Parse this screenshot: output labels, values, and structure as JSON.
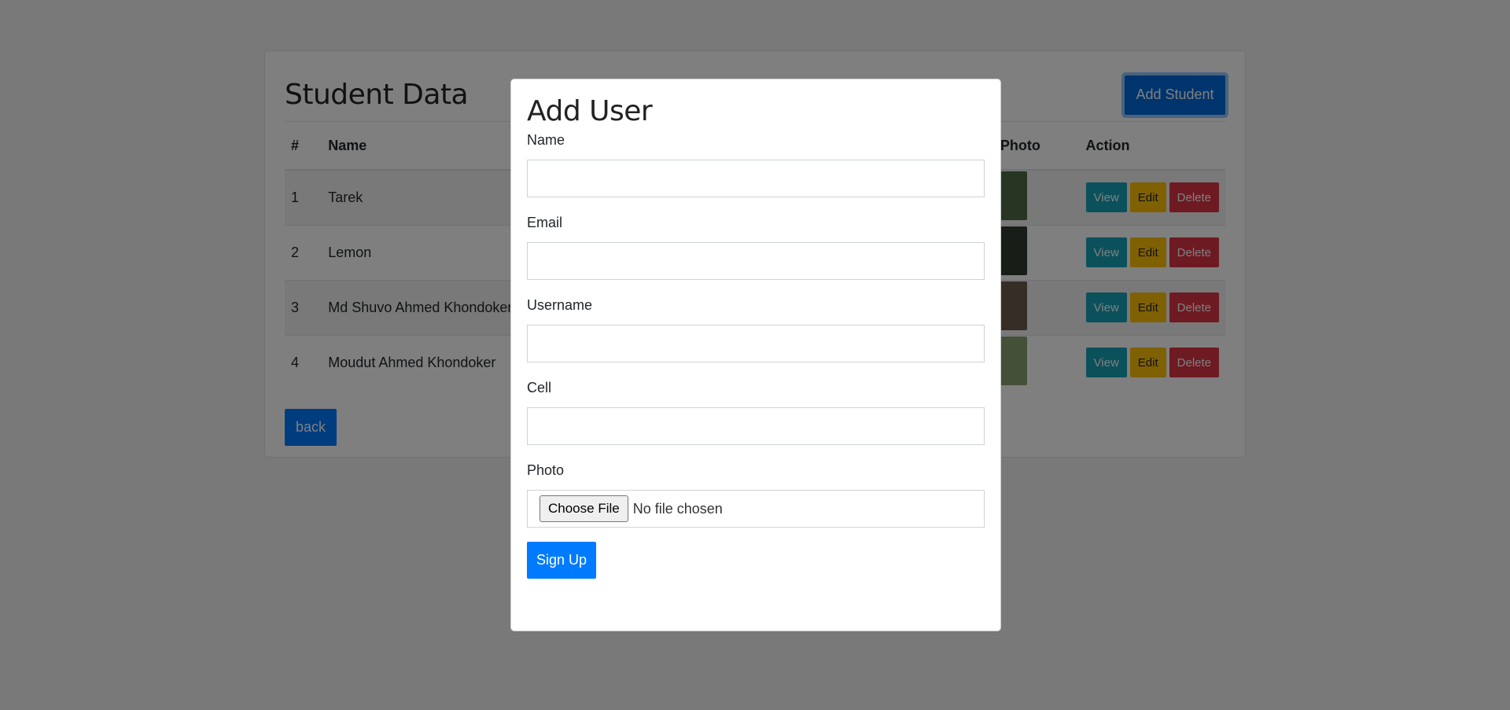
{
  "page": {
    "title": "Student Data",
    "add_button": "Add Student",
    "back_button": "back"
  },
  "table": {
    "headers": [
      "#",
      "Name",
      "Photo",
      "Action"
    ],
    "rows": [
      {
        "num": "1",
        "name": "Tarek",
        "photo_color": "#4f6b44"
      },
      {
        "num": "2",
        "name": "Lemon",
        "photo_color": "#2f3b2f"
      },
      {
        "num": "3",
        "name": "Md Shuvo Ahmed Khondoker",
        "photo_color": "#6e5a4e"
      },
      {
        "num": "4",
        "name": "Moudut Ahmed Khondoker",
        "photo_color": "#8aa070"
      }
    ],
    "actions": {
      "view": "View",
      "edit": "Edit",
      "delete": "Delete"
    }
  },
  "modal": {
    "title": "Add User",
    "fields": {
      "name": {
        "label": "Name",
        "value": ""
      },
      "email": {
        "label": "Email",
        "value": ""
      },
      "username": {
        "label": "Username",
        "value": ""
      },
      "cell": {
        "label": "Cell",
        "value": ""
      }
    },
    "photo": {
      "label": "Photo",
      "button": "Choose File",
      "status": "No file chosen"
    },
    "submit": "Sign Up"
  },
  "colors": {
    "primary": "#007bff",
    "info": "#17a2b8",
    "warning": "#ffc107",
    "danger": "#dc3545"
  }
}
